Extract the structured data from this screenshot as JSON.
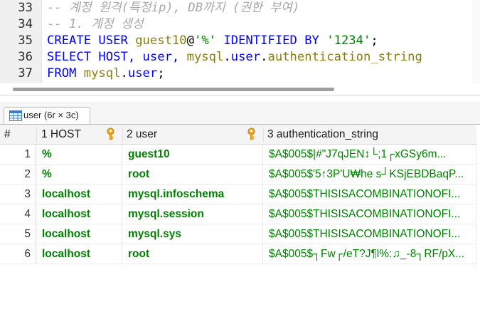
{
  "editor": {
    "lines": [
      {
        "no": "33",
        "tokens": [
          {
            "t": "-- 계정 원격(특정ip), DB까지 (권한 부여)",
            "c": "cm"
          }
        ]
      },
      {
        "no": "34",
        "tokens": [
          {
            "t": "-- 1. 계정 생성",
            "c": "cm"
          }
        ]
      },
      {
        "no": "35",
        "tokens": [
          {
            "t": "CREATE USER ",
            "c": "kw"
          },
          {
            "t": "guest10",
            "c": "id"
          },
          {
            "t": "@",
            "c": "pl"
          },
          {
            "t": "'%'",
            "c": "st"
          },
          {
            "t": " IDENTIFIED BY ",
            "c": "kw"
          },
          {
            "t": "'1234'",
            "c": "st"
          },
          {
            "t": ";",
            "c": "pl"
          }
        ]
      },
      {
        "no": "36",
        "tokens": [
          {
            "t": "SELECT HOST, user, ",
            "c": "kw"
          },
          {
            "t": "mysql",
            "c": "id"
          },
          {
            "t": ".",
            "c": "pl"
          },
          {
            "t": "user",
            "c": "kw"
          },
          {
            "t": ".",
            "c": "pl"
          },
          {
            "t": "authentication_string",
            "c": "id"
          }
        ]
      },
      {
        "no": "37",
        "tokens": [
          {
            "t": "FROM ",
            "c": "kw"
          },
          {
            "t": "mysql",
            "c": "id"
          },
          {
            "t": ".",
            "c": "pl"
          },
          {
            "t": "user",
            "c": "kw"
          },
          {
            "t": ";",
            "c": "pl"
          }
        ]
      }
    ]
  },
  "result_tab": {
    "label": "user (6r × 3c)",
    "icon": "table-grid-icon"
  },
  "grid": {
    "header": {
      "rownum": "#",
      "columns": [
        "1 HOST",
        "2 user",
        "3 authentication_string"
      ],
      "key_icon": "primary-key-icon"
    },
    "rows": [
      {
        "n": "1",
        "host": "%",
        "user": "guest10",
        "auth": "$A$005$|#\u0005\"J7qJEN↕└;◀1┌xGSy6m..."
      },
      {
        "n": "2",
        "host": "%",
        "user": "root",
        "auth": "$A$005$'5↑3P'U₩he s┘KSjEBDBaqP..."
      },
      {
        "n": "3",
        "host": "localhost",
        "user": "mysql.infoschema",
        "auth": "$A$005$THISISACOMBINATIONOFI..."
      },
      {
        "n": "4",
        "host": "localhost",
        "user": "mysql.session",
        "auth": "$A$005$THISISACOMBINATIONOFI..."
      },
      {
        "n": "5",
        "host": "localhost",
        "user": "mysql.sys",
        "auth": "$A$005$THISISACOMBINATIONOFI..."
      },
      {
        "n": "6",
        "host": "localhost",
        "user": "root",
        "auth": "$A$005$┐Fw┌/eT?J¶l%:♫_-8┐RF/pX..."
      }
    ]
  },
  "colors": {
    "keyword": "#0000ff",
    "identifier": "#8b7d0b",
    "string": "#008000",
    "comment": "#a8a8a8",
    "cell_text": "#008000"
  }
}
